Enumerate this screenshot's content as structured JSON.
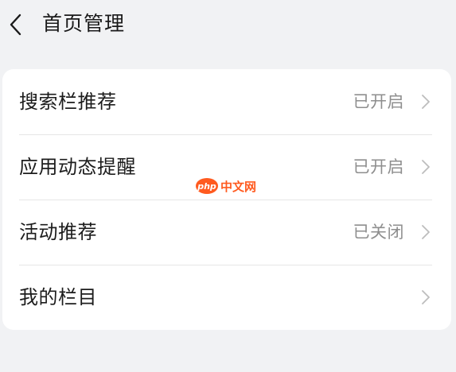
{
  "header": {
    "back_icon": "chevron-left-icon",
    "title": "首页管理"
  },
  "settings": {
    "items": [
      {
        "label": "搜索栏推荐",
        "status": "已开启"
      },
      {
        "label": "应用动态提醒",
        "status": "已开启"
      },
      {
        "label": "活动推荐",
        "status": "已关闭"
      },
      {
        "label": "我的栏目",
        "status": ""
      }
    ],
    "chevron_icon": "chevron-right-icon"
  },
  "watermark": {
    "badge": "php",
    "text": "中文网"
  },
  "colors": {
    "background": "#f1f2f4",
    "card": "#ffffff",
    "status_text": "#8e8e8e",
    "watermark": "#ff5a1f"
  }
}
